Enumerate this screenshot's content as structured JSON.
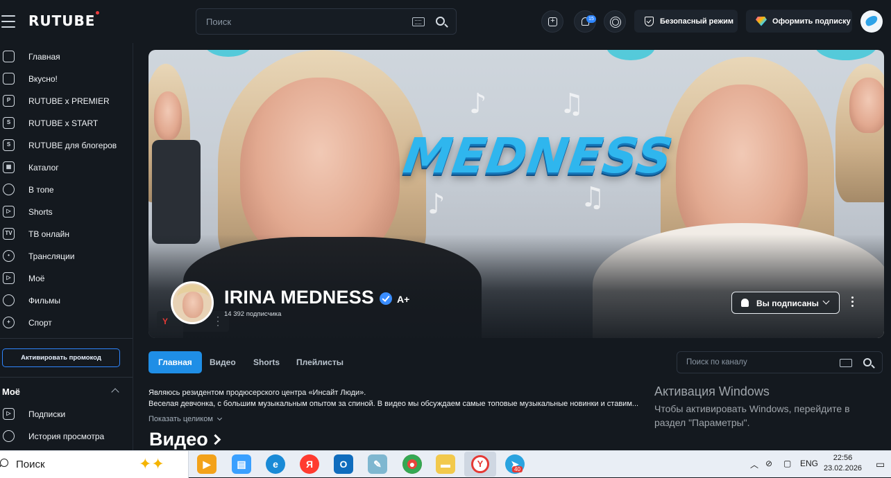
{
  "header": {
    "logo": "RUTUBE",
    "search_placeholder": "Поиск",
    "notifications_count": "15",
    "safe_mode_label": "Безопасный режим",
    "subscribe_label": "Оформить подписку"
  },
  "sidebar": {
    "items": [
      {
        "label": "Главная",
        "icon": "home-icon"
      },
      {
        "label": "Вкусно!",
        "icon": "dish-icon"
      },
      {
        "label": "RUTUBE x PREMIER",
        "icon": "premier-icon"
      },
      {
        "label": "RUTUBE x START",
        "icon": "start-icon"
      },
      {
        "label": "RUTUBE для блогеров",
        "icon": "blogger-icon"
      },
      {
        "label": "Каталог",
        "icon": "catalog-icon"
      },
      {
        "label": "В топе",
        "icon": "rocket-icon"
      },
      {
        "label": "Shorts",
        "icon": "shorts-icon"
      },
      {
        "label": "ТВ онлайн",
        "icon": "tv-icon"
      },
      {
        "label": "Трансляции",
        "icon": "broadcast-icon"
      },
      {
        "label": "Моё",
        "icon": "my-icon"
      },
      {
        "label": "Фильмы",
        "icon": "film-icon"
      },
      {
        "label": "Спорт",
        "icon": "sport-icon"
      }
    ],
    "promo_label": "Активировать промокод",
    "my_section_title": "Моё",
    "my_items": [
      {
        "label": "Подписки",
        "icon": "subscriptions-icon"
      },
      {
        "label": "История просмотра",
        "icon": "history-icon"
      }
    ]
  },
  "channel": {
    "banner_title": "MEDNESS",
    "name": "IRINA MEDNESS",
    "badge": "A+",
    "subscribers": "14 392 подписчика",
    "subscribed_label": "Вы подписаны",
    "tabs": [
      "Главная",
      "Видео",
      "Shorts",
      "Плейлисты"
    ],
    "active_tab": "Главная",
    "search_placeholder": "Поиск по каналу",
    "description": [
      "Являюсь резидентом продюсерского центра «Инсайт Люди».",
      "Веселая девчонка, с большим музыкальным опытом за спиной. В видео мы обсуждаем самые топовые музыкальные новинки и ставим..."
    ],
    "show_all_label": "Показать целиком",
    "section_title": "Видео"
  },
  "windows_activation": {
    "title": "Активация Windows",
    "line1": "Чтобы активировать Windows, перейдите в",
    "line2": "раздел \"Параметры\"."
  },
  "taskbar": {
    "search_placeholder": "Поиск",
    "telegram_badge": "40",
    "language": "ENG",
    "time": "22:56",
    "date": "23.02.2026"
  }
}
